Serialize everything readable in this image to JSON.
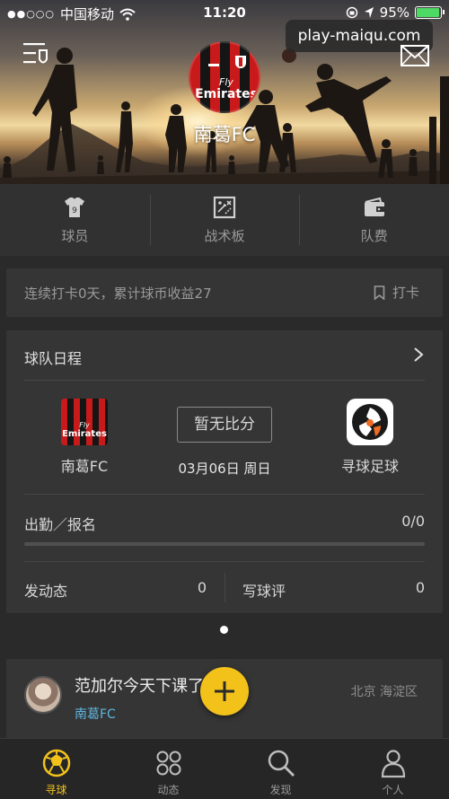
{
  "status_bar": {
    "signal": "●●○○○",
    "carrier": "中国移动",
    "time": "11:20",
    "battery_percent": "95%",
    "battery_level": 0.95
  },
  "watermark": "play-maiqu.com",
  "header": {
    "team_name": "南葛FC",
    "logo_sponsor_line1": "Fly",
    "logo_sponsor_line2": "Emirates"
  },
  "quick_actions": [
    {
      "label": "球员",
      "icon": "jersey-icon"
    },
    {
      "label": "战术板",
      "icon": "tactics-board-icon"
    },
    {
      "label": "队费",
      "icon": "wallet-icon"
    }
  ],
  "checkin": {
    "text": "连续打卡0天，累计球币收益27",
    "button_label": "打卡"
  },
  "schedule": {
    "title": "球队日程",
    "home_team": "南葛FC",
    "away_team": "寻球足球",
    "score": "暂无比分",
    "date": "03月06日 周日",
    "attendance_label": "出勤／报名",
    "attendance_value": "0/0",
    "attendance_progress": 0,
    "post_label": "发动态",
    "post_count": "0",
    "review_label": "写球评",
    "review_count": "0"
  },
  "feed": {
    "message": "范加尔今天下课了没有",
    "team": "南葛FC",
    "location": "北京 海淀区"
  },
  "fab_symbol": "+",
  "tabs": [
    {
      "label": "寻球",
      "active": true
    },
    {
      "label": "动态",
      "active": false
    },
    {
      "label": "发现",
      "active": false
    },
    {
      "label": "个人",
      "active": false
    }
  ],
  "colors": {
    "accent": "#f2c21b",
    "link": "#5fb6e0",
    "background": "#2a2a2a",
    "card": "#353535"
  }
}
